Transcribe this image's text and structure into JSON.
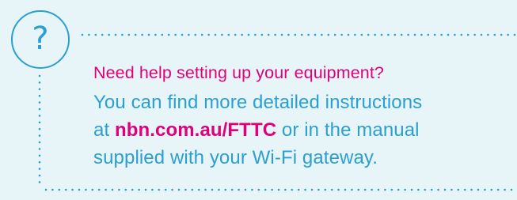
{
  "help_panel": {
    "icon_glyph": "?",
    "icon_name": "question-mark-icon",
    "heading": "Need help setting up your equipment?",
    "body": {
      "line1": "You can find more detailed instructions",
      "line2_prefix": "at ",
      "link_text": "nbn.com.au/FTTC",
      "line2_suffix": " or in the manual",
      "line3": "supplied with your Wi-Fi gateway."
    }
  },
  "colors": {
    "background": "#e7f5f8",
    "accent_blue": "#2b9fd0",
    "accent_pink": "#e0007a"
  }
}
